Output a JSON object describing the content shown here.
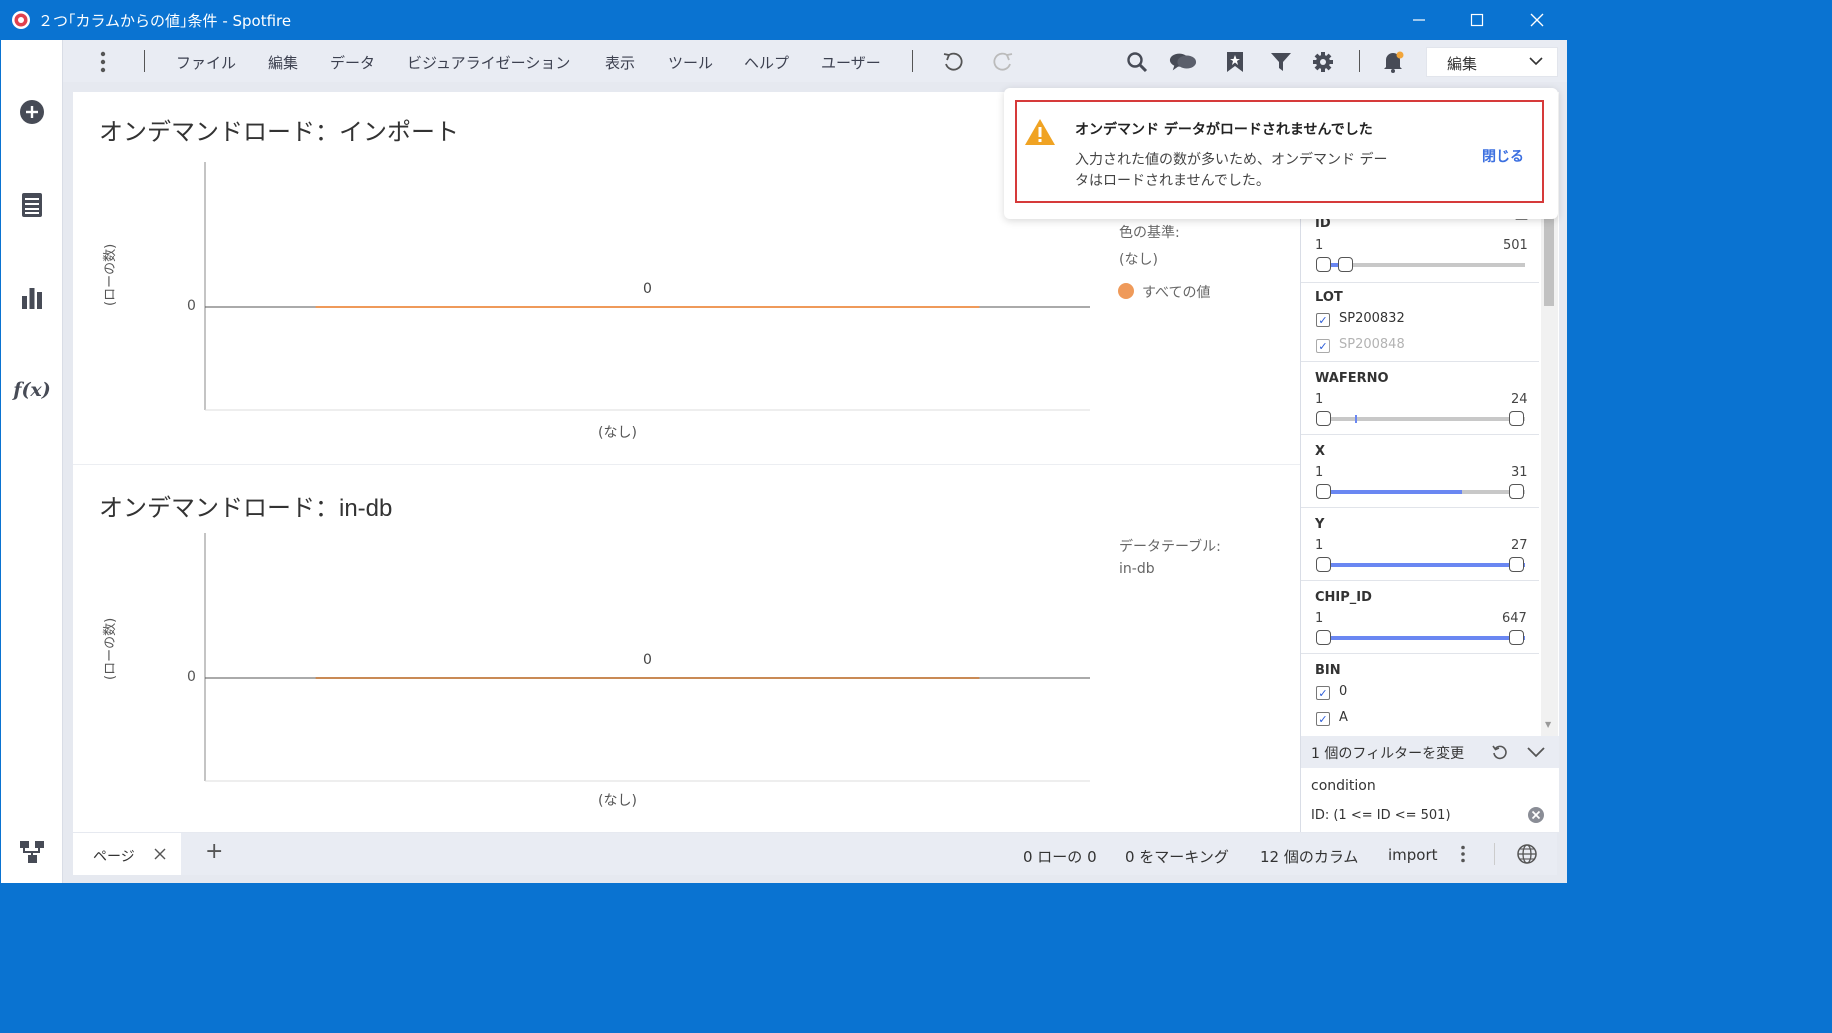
{
  "window": {
    "title": "２つ｢カラムからの値｣条件 - Spotfire"
  },
  "menu": {
    "items": [
      "ファイル",
      "編集",
      "データ",
      "ビジュアライゼーション",
      "表示",
      "ツール",
      "ヘルプ",
      "ユーザー"
    ],
    "mode_label": "編集"
  },
  "viz1": {
    "title": "オンデマンドロード：インポート",
    "ylabel": "(ローの数)",
    "y_tick": "0",
    "x_label": "(なし)",
    "legend_heading": "色の基準:",
    "legend_value": "(なし)",
    "legend_item": "すべての値",
    "legend_color": "#ef9a5a"
  },
  "viz2": {
    "title_jp": "オンデマンドロード：",
    "title_db": "in-db",
    "ylabel": "(ローの数)",
    "y_tick": "0",
    "x_label": "(なし)",
    "legend_heading": "データテーブル:",
    "legend_value": "in-db"
  },
  "chart_data": [
    {
      "type": "bar",
      "title": "オンデマンドロード：インポート",
      "categories": [
        "(なし)"
      ],
      "values": [
        0
      ],
      "ylabel": "(ローの数)",
      "data_labels": [
        "0"
      ]
    },
    {
      "type": "bar",
      "title": "オンデマンドロード：in-db",
      "categories": [
        "(なし)"
      ],
      "values": [
        0
      ],
      "ylabel": "(ローの数)",
      "data_labels": [
        "0"
      ]
    }
  ],
  "notification": {
    "title": "オンデマンド データがロードされませんでした",
    "body_line1": "入力された値の数が多いため、オンデマンド デー",
    "body_line2": "タはロードされませんでした。",
    "close_label": "閉じる"
  },
  "filters": {
    "id": {
      "name": "ID",
      "min": "1",
      "max": "501",
      "collapse": "—"
    },
    "lot": {
      "name": "LOT",
      "items": [
        "SP200832",
        "SP200848"
      ]
    },
    "waferno": {
      "name": "WAFERNO",
      "min": "1",
      "max": "24"
    },
    "x": {
      "name": "X",
      "min": "1",
      "max": "31"
    },
    "y": {
      "name": "Y",
      "min": "1",
      "max": "27"
    },
    "chip_id": {
      "name": "CHIP_ID",
      "min": "1",
      "max": "647"
    },
    "bin": {
      "name": "BIN",
      "items": [
        "0",
        "A"
      ]
    },
    "summary": "1 個のフィルターを変更",
    "condition_title": "condition",
    "condition_text": "ID: (1 <= ID <= 501)"
  },
  "statusbar": {
    "page_tab": "ページ",
    "add": "+",
    "rows": "0 ローの 0",
    "marked": "0 をマーキング",
    "columns": "12 個のカラム",
    "table": "import"
  }
}
